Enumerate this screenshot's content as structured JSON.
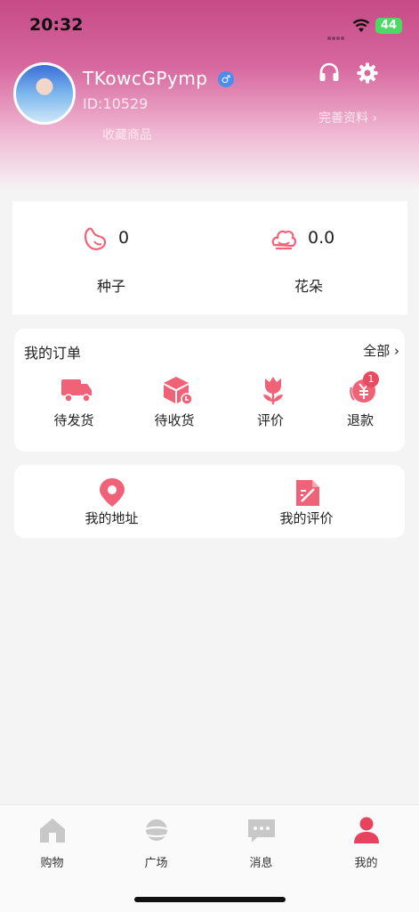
{
  "status": {
    "time": "20:32",
    "battery": "44"
  },
  "profile": {
    "username": "TKowcGPymp",
    "gender": "♂",
    "id_label": "ID:10529",
    "favorites_link": "收藏商品",
    "complete_profile": "完善资料 ›"
  },
  "assets": {
    "seeds": {
      "value": "0",
      "label": "种子"
    },
    "flowers": {
      "value": "0.0",
      "label": "花朵"
    }
  },
  "orders": {
    "title": "我的订单",
    "all_label": "全部 ›",
    "items": [
      {
        "label": "待发货",
        "icon": "truck-icon"
      },
      {
        "label": "待收货",
        "icon": "box-icon"
      },
      {
        "label": "评价",
        "icon": "tulip-icon"
      },
      {
        "label": "退款",
        "icon": "refund-icon",
        "badge": "1"
      }
    ]
  },
  "tools": {
    "address": "我的地址",
    "reviews": "我的评价"
  },
  "tabbar": {
    "items": [
      {
        "label": "购物",
        "icon": "home-icon"
      },
      {
        "label": "广场",
        "icon": "planet-icon"
      },
      {
        "label": "消息",
        "icon": "message-icon"
      },
      {
        "label": "我的",
        "icon": "person-icon",
        "active": true
      }
    ]
  },
  "colors": {
    "accent": "#f06278",
    "header": "#c64a86",
    "inactive_icon": "#c8c8c8"
  }
}
